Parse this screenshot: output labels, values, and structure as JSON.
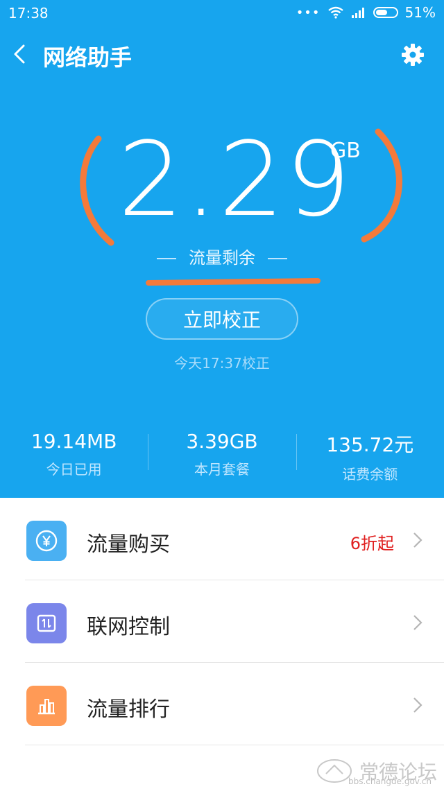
{
  "status": {
    "time": "17:38",
    "battery": "51%",
    "dots": "•••"
  },
  "header": {
    "title": "网络助手"
  },
  "data_remaining": {
    "value": "2.29",
    "unit": "GB",
    "label": "流量剩余"
  },
  "calibrate": {
    "button_label": "立即校正",
    "last_calibrated": "今天17:37校正"
  },
  "stats": [
    {
      "value": "19.14MB",
      "label": "今日已用"
    },
    {
      "value": "3.39GB",
      "label": "本月套餐"
    },
    {
      "value": "135.72元",
      "label": "话费余额"
    }
  ],
  "list": [
    {
      "label": "流量购买",
      "promo": "6折起",
      "icon": "yen-coin-icon",
      "color": "#4ab0f2"
    },
    {
      "label": "联网控制",
      "icon": "network-toggle-icon",
      "color": "#7b86ea"
    },
    {
      "label": "流量排行",
      "icon": "bar-chart-icon",
      "color": "#ff9a56"
    }
  ],
  "watermark": {
    "text": "常德论坛",
    "url": "bbs.changde.gov.cn"
  },
  "colors": {
    "hero_bg": "#17a5ee",
    "annotation": "#f47a3a",
    "promo": "#e02020"
  }
}
